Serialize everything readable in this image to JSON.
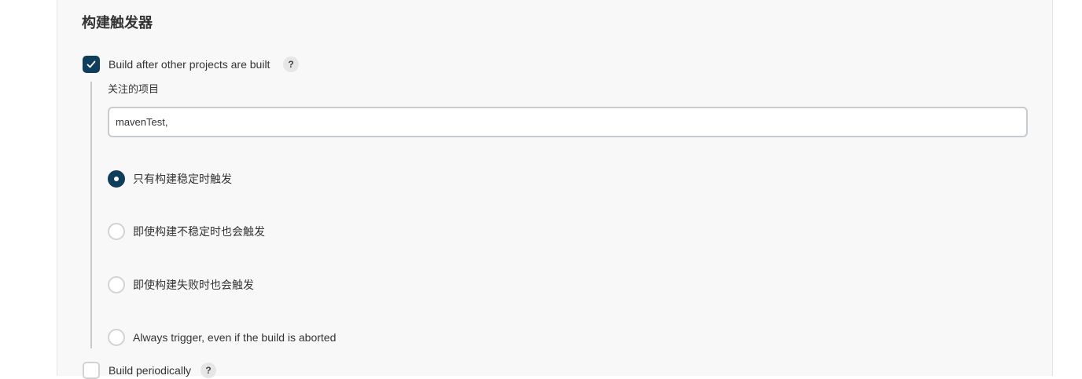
{
  "section": {
    "title": "构建触发器"
  },
  "trigger_after_other": {
    "label": "Build after other projects are built",
    "checked": true,
    "help": "?",
    "projects_label": "关注的项目",
    "projects_value": "mavenTest,"
  },
  "radio_options": [
    {
      "label": "只有构建稳定时触发",
      "selected": true
    },
    {
      "label": "即使构建不稳定时也会触发",
      "selected": false
    },
    {
      "label": "即使构建失败时也会触发",
      "selected": false
    },
    {
      "label": "Always trigger, even if the build is aborted",
      "selected": false
    }
  ],
  "build_periodically": {
    "label": "Build periodically",
    "checked": false,
    "help": "?"
  },
  "colors": {
    "accent": "#0e3e5e",
    "panel_bg": "#f8f8f8",
    "border": "#c6cbcf"
  }
}
